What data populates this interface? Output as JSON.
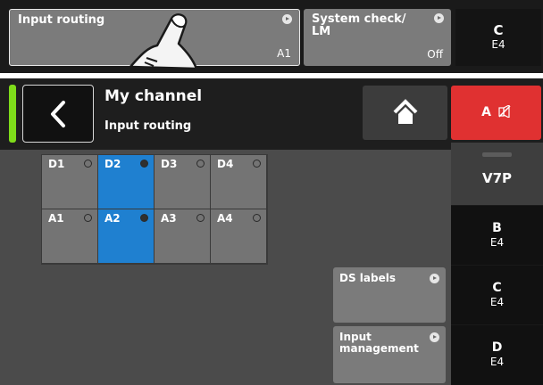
{
  "top_bar": {
    "input_routing": {
      "label": "Input routing",
      "value": "A1"
    },
    "system_check": {
      "label": "System check/\nLM",
      "value": "Off"
    },
    "channel": {
      "letter": "C",
      "sub": "E4"
    }
  },
  "header": {
    "title": "My channel",
    "subtitle": "Input routing",
    "mute_label": "A"
  },
  "routing_grid": {
    "rows": [
      [
        {
          "label": "D1",
          "selected": false
        },
        {
          "label": "D2",
          "selected": true
        },
        {
          "label": "D3",
          "selected": false
        },
        {
          "label": "D4",
          "selected": false
        }
      ],
      [
        {
          "label": "A1",
          "selected": false
        },
        {
          "label": "A2",
          "selected": true
        },
        {
          "label": "A3",
          "selected": false
        },
        {
          "label": "A4",
          "selected": false
        }
      ]
    ]
  },
  "buttons": {
    "ds_labels": "DS labels",
    "input_management": "Input\nmanagement"
  },
  "channels": [
    {
      "letter": "V7P",
      "sub": ""
    },
    {
      "letter": "B",
      "sub": "E4"
    },
    {
      "letter": "C",
      "sub": "E4"
    },
    {
      "letter": "D",
      "sub": "E4"
    }
  ],
  "colors": {
    "selected": "#1f80d0",
    "mute": "#e03131",
    "active_indicator": "#7fdc1a"
  }
}
